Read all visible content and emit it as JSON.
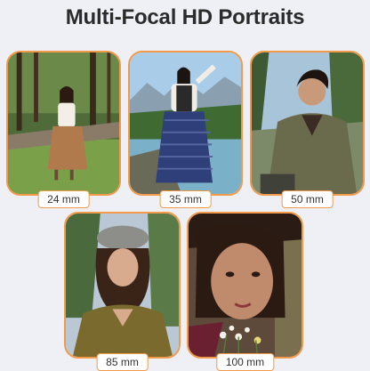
{
  "title": "Multi-Focal HD Portraits",
  "accent_color": "#f29a4a",
  "tiles": [
    {
      "focal": "24 mm",
      "scene": "woman sitting on fallen log in forest"
    },
    {
      "focal": "35 mm",
      "scene": "woman on rock by mountain river"
    },
    {
      "focal": "50 mm",
      "scene": "man in olive shirt outdoors"
    },
    {
      "focal": "85 mm",
      "scene": "woman in grey beret and olive sweater"
    },
    {
      "focal": "100 mm",
      "scene": "close-up of woman with flowers"
    }
  ]
}
